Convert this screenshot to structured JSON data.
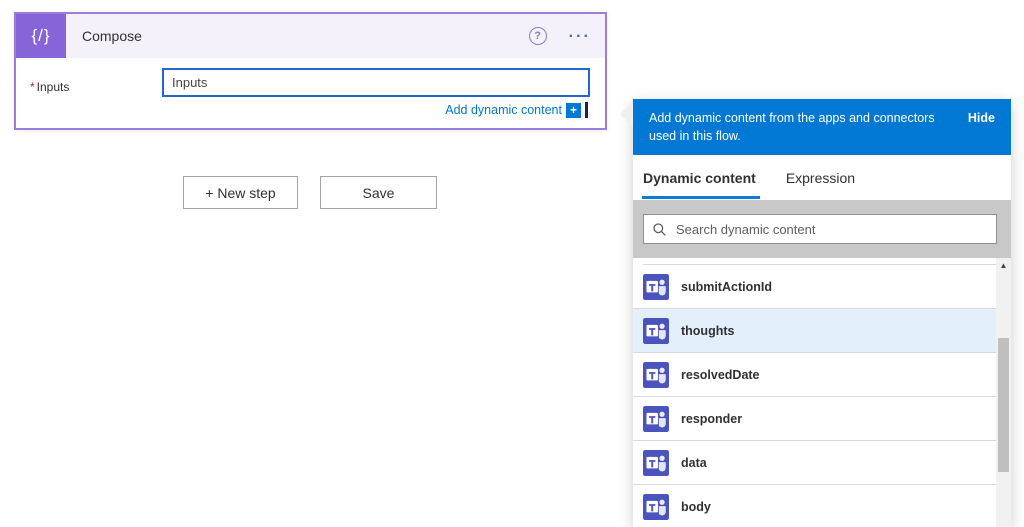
{
  "compose_card": {
    "title": "Compose",
    "icon_glyph": "{/}",
    "required_marker": "*",
    "input_label": "Inputs",
    "input_placeholder": "Inputs",
    "add_dynamic_label": "Add dynamic content"
  },
  "actions": {
    "new_step_label": "+ New step",
    "save_label": "Save"
  },
  "panel": {
    "header_message": "Add dynamic content from the apps and connectors used in this flow.",
    "hide_label": "Hide",
    "tabs": [
      {
        "label": "Dynamic content",
        "active": true
      },
      {
        "label": "Expression",
        "active": false
      }
    ],
    "search_placeholder": "Search dynamic content",
    "items": [
      {
        "label": "submitActionId",
        "selected": false,
        "icon": "teams-icon"
      },
      {
        "label": "thoughts",
        "selected": true,
        "icon": "teams-icon"
      },
      {
        "label": "resolvedDate",
        "selected": false,
        "icon": "teams-icon"
      },
      {
        "label": "responder",
        "selected": false,
        "icon": "teams-icon"
      },
      {
        "label": "data",
        "selected": false,
        "icon": "teams-icon"
      },
      {
        "label": "body",
        "selected": false,
        "icon": "teams-icon"
      }
    ]
  },
  "colors": {
    "accent_blue": "#0078d4",
    "compose_purple": "#8764d8",
    "card_border_purple": "#9a7fd9",
    "input_focus_blue": "#2266d3",
    "teams_icon_indigo": "#4b53bc",
    "selected_row_bg": "#e4effc",
    "search_strip_gray": "#c8c8c8"
  }
}
